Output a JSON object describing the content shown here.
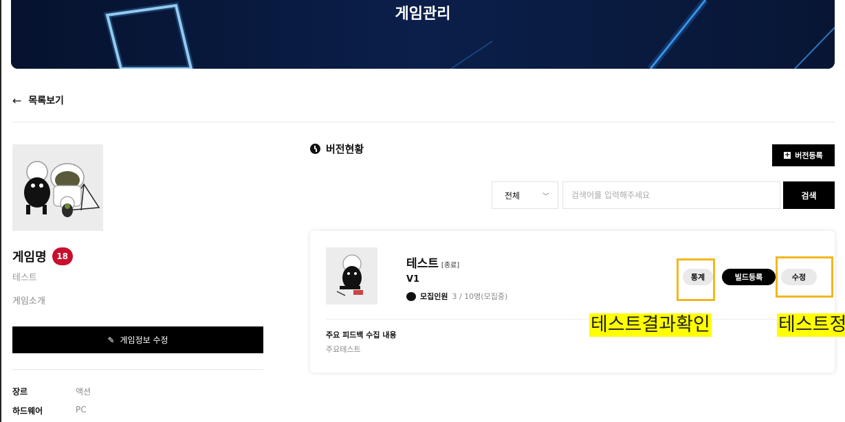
{
  "banner": {
    "title": "게임관리"
  },
  "nav": {
    "back_label": "목록보기"
  },
  "game": {
    "name": "게임명",
    "age_rating": "18",
    "subtitle": "테스트",
    "intro": "게임소개",
    "edit_button": "게임정보 수정",
    "info": [
      {
        "key": "장르",
        "value": "액션"
      },
      {
        "key": "하드웨어",
        "value": "PC"
      }
    ]
  },
  "versions": {
    "section_title": "버전현황",
    "register_button": "버전등록",
    "filter": {
      "selected": "전체"
    },
    "search": {
      "placeholder": "검색어를 입력해주세요",
      "button": "검색"
    },
    "card": {
      "title": "테스트",
      "status": "[종료]",
      "version": "V1",
      "recruit_label": "모집인원",
      "recruit_value": "3 / 10명(모집중)",
      "feedback_title": "주요 피드백 수집 내용",
      "feedback_body": "주요테스트",
      "buttons": {
        "stats": "통계",
        "build": "빌드등록",
        "edit": "수정"
      }
    }
  },
  "annotations": {
    "stats_label": "테스트결과확인",
    "edit_label": "테스트정"
  },
  "colors": {
    "banner_bg": "#0a1a3f",
    "age_badge": "#c8102e",
    "highlight_border": "#f2b71f",
    "highlight_fill": "#ffff00"
  }
}
